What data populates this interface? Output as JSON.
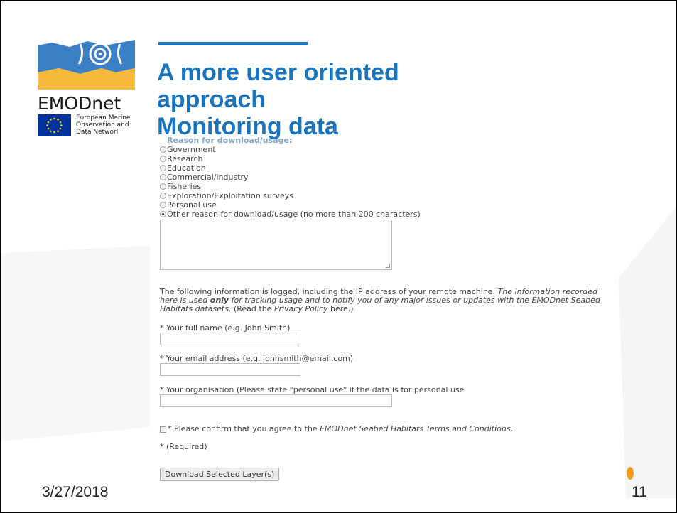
{
  "slide": {
    "title_lines": [
      "A more user oriented",
      "approach",
      "Monitoring data"
    ],
    "date": "3/27/2018",
    "page_number": "11"
  },
  "branding": {
    "logo_word": "EMODnet",
    "eu_lines": [
      "European Marine",
      "Observation and",
      "Data Networl"
    ],
    "colors": {
      "blue": "#1a74be",
      "yellow": "#f6b93b",
      "orange": "#f39a1a"
    }
  },
  "form": {
    "question_label": "Reason for download/usage:",
    "options": [
      {
        "label": "Government",
        "checked": false
      },
      {
        "label": "Research",
        "checked": false
      },
      {
        "label": "Education",
        "checked": false
      },
      {
        "label": "Commercial/industry",
        "checked": false
      },
      {
        "label": "Fisheries",
        "checked": false
      },
      {
        "label": "Exploration/Exploitation surveys",
        "checked": false
      },
      {
        "label": "Personal use",
        "checked": false
      },
      {
        "label": "Other reason for download/usage (no more than 200 characters)",
        "checked": true
      }
    ],
    "other_reason_value": "",
    "info": {
      "part1": "The following information is logged, including the IP address of your remote machine.  ",
      "part2": "The information recorded here is used ",
      "part3": "only",
      "part4": " for tracking usage and to notify you of any major issues or updates with the EMODnet Seabed Habitats datasets.",
      "part5": "  (Read the ",
      "part6": "Privacy Policy",
      "part7": " here.)"
    },
    "name_label": "* Your full name (e.g. John Smith)",
    "name_value": "",
    "email_label": "* Your email address (e.g. johnsmith@email.com)",
    "email_value": "",
    "org_label": "* Your organisation (Please state \"personal use\" if the data is for personal use",
    "org_value": "",
    "confirm_prefix": "* Please confirm that you agree to the ",
    "confirm_link": "EMODnet Seabed Habitats Terms and Conditions",
    "confirm_suffix": ".",
    "required_note": "* (Required)",
    "download_button": "Download Selected Layer(s)"
  }
}
